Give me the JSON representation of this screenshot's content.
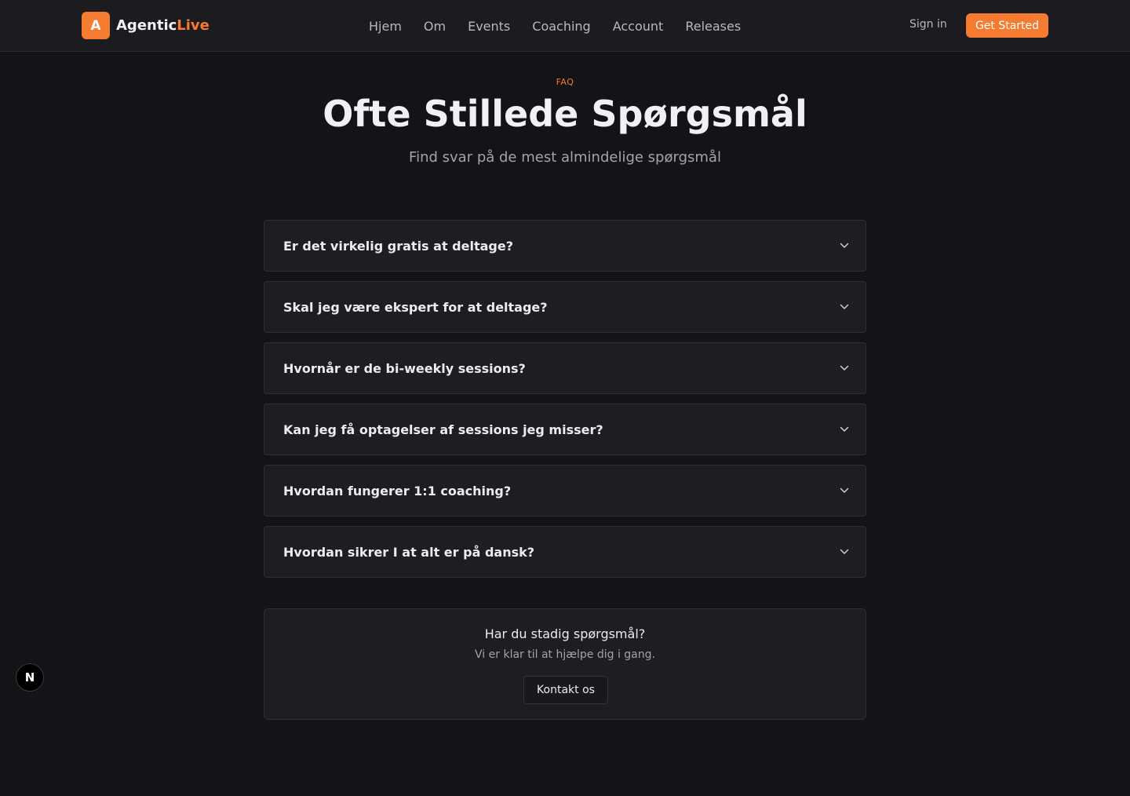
{
  "header": {
    "brand_badge": "A",
    "brand_name": "Agentic",
    "brand_accent": "Live",
    "nav": [
      "Hjem",
      "Om",
      "Events",
      "Coaching",
      "Account",
      "Releases"
    ],
    "sign_in": "Sign in",
    "cta": "Get Started"
  },
  "hero": {
    "eyebrow": "FAQ",
    "title": "Ofte Stillede Spørgsmål",
    "subtitle": "Find svar på de mest almindelige spørgsmål"
  },
  "faq": {
    "items": [
      {
        "question": "Er det virkelig gratis at deltage?",
        "icon": "chevron-down-icon"
      },
      {
        "question": "Skal jeg være ekspert for at deltage?",
        "icon": "chevron-down-icon"
      },
      {
        "question": "Hvornår er de bi-weekly sessions?",
        "icon": "chevron-down-icon"
      },
      {
        "question": "Kan jeg få optagelser af sessions jeg misser?",
        "icon": "chevron-down-icon"
      },
      {
        "question": "Hvordan fungerer 1:1 coaching?",
        "icon": "chevron-down-icon"
      },
      {
        "question": "Hvordan sikrer I at alt er på dansk?",
        "icon": "chevron-down-icon"
      }
    ]
  },
  "contact": {
    "title": "Har du stadig spørgsmål?",
    "text": "Vi er klar til at hjælpe dig i gang.",
    "button": "Kontakt os"
  },
  "dev_badge": {
    "letter": "N",
    "icon": "nextjs-icon"
  },
  "colors": {
    "accent": "#f47b2f",
    "background": "#141317",
    "surface": "#1e1d23",
    "header": "#1c1b20"
  }
}
